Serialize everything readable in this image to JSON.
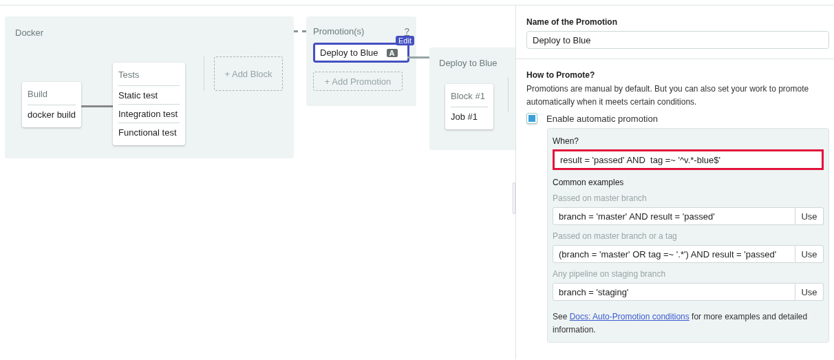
{
  "docker_pipeline": {
    "title": "Docker",
    "blocks": [
      {
        "title": "Build",
        "jobs": [
          "docker build"
        ]
      },
      {
        "title": "Tests",
        "jobs": [
          "Static test",
          "Integration test",
          "Functional test"
        ]
      }
    ],
    "add_block_label": "+ Add Block"
  },
  "promotions": {
    "title": "Promotion(s)",
    "help": "?",
    "items": [
      {
        "name": "Deploy to Blue",
        "badge": "A",
        "edit_label": "Edit",
        "selected": true
      }
    ],
    "add_label": "+ Add Promotion"
  },
  "promoted_pipeline": {
    "title": "Deploy to Blue",
    "blocks": [
      {
        "title": "Block #1",
        "jobs": [
          "Job #1"
        ]
      }
    ]
  },
  "form": {
    "name_label": "Name of the Promotion",
    "name_value": "Deploy to Blue",
    "how_title": "How to Promote?",
    "how_text": "Promotions are manual by default. But you can also set your work to promote automatically when it meets certain conditions.",
    "auto": {
      "label": "Enable automatic promotion",
      "checked": true
    },
    "when_label": "When?",
    "when_value": "result = 'passed' AND  tag =~ '^v.*-blue$'",
    "when_highlighted": true,
    "examples_title": "Common examples",
    "examples": [
      {
        "label": "Passed on master branch",
        "value": "branch = 'master' AND result = 'passed'",
        "button": "Use"
      },
      {
        "label": "Passed on master branch or a tag",
        "value": "(branch = 'master' OR tag =~ '.*') AND result = 'passed'",
        "button": "Use"
      },
      {
        "label": "Any pipeline on staging branch",
        "value": "branch = 'staging'",
        "button": "Use"
      }
    ],
    "footer": {
      "prefix": "See ",
      "link": "Docs: Auto-Promotion conditions",
      "suffix": " for more examples and detailed information."
    }
  }
}
